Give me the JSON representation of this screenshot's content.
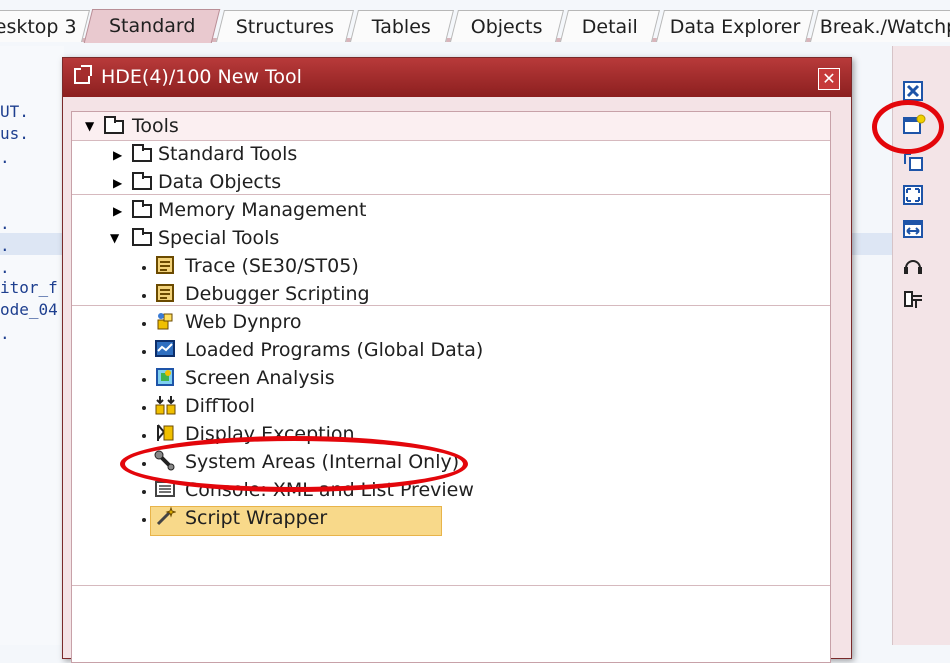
{
  "tabs": [
    {
      "label": "esktop 3"
    },
    {
      "label": "Standard"
    },
    {
      "label": "Structures"
    },
    {
      "label": "Tables"
    },
    {
      "label": "Objects"
    },
    {
      "label": "Detail"
    },
    {
      "label": "Data Explorer"
    },
    {
      "label": "Break./Watchp"
    }
  ],
  "active_tab": "Standard",
  "editor_lines": [
    "UT.",
    "us.",
    ".",
    "",
    "",
    ".",
    ".",
    ".",
    "itor_f",
    "ode_04",
    "."
  ],
  "dialog": {
    "title": "HDE(4)/100 New Tool",
    "close_icon": "close-icon",
    "tree": {
      "root": "Tools",
      "folders": [
        "Standard Tools",
        "Data Objects",
        "Memory Management",
        "Special Tools"
      ],
      "special_tools": [
        {
          "label": "Trace (SE30/ST05)",
          "icon": "script-icon"
        },
        {
          "label": "Debugger Scripting",
          "icon": "script-icon"
        },
        {
          "label": "Web Dynpro",
          "icon": "web-dynpro-icon"
        },
        {
          "label": "Loaded Programs (Global Data)",
          "icon": "monitor-icon"
        },
        {
          "label": "Screen Analysis",
          "icon": "screen-icon"
        },
        {
          "label": "DiffTool",
          "icon": "diff-icon"
        },
        {
          "label": "Display Exception",
          "icon": "exception-icon"
        },
        {
          "label": "System Areas (Internal Only)",
          "icon": "wrench-icon"
        },
        {
          "label": "Console: XML and List Preview",
          "icon": "console-icon"
        },
        {
          "label": "Script Wrapper",
          "icon": "wand-icon"
        }
      ],
      "selected": "System Areas (Internal Only)"
    }
  },
  "right_toolbar": [
    "close-icon",
    "new-tool-icon",
    "swap-icon",
    "maximize-icon",
    "resize-icon",
    "headset-icon",
    "services-icon"
  ],
  "colors": {
    "accent": "#a52d2d",
    "highlight": "#f8d98a",
    "annotation": "#e3060b"
  }
}
